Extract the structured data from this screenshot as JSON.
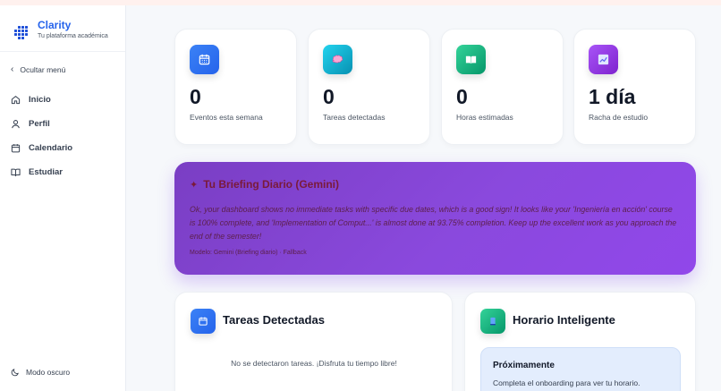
{
  "brand": {
    "name": "Clarity",
    "subtitle": "Tu plataforma académica"
  },
  "sidebar": {
    "collapse_label": "Ocultar menú",
    "items": [
      {
        "label": "Inicio",
        "icon": "home-icon"
      },
      {
        "label": "Perfil",
        "icon": "user-icon"
      },
      {
        "label": "Calendario",
        "icon": "calendar-icon"
      },
      {
        "label": "Estudiar",
        "icon": "book-icon"
      }
    ],
    "dark_mode_label": "Modo oscuro"
  },
  "stats": [
    {
      "value": "0",
      "label": "Eventos esta semana",
      "icon": "calendar-icon",
      "color": "#3b82f6"
    },
    {
      "value": "0",
      "label": "Tareas detectadas",
      "icon": "brain-icon",
      "color": "#06b6d4"
    },
    {
      "value": "0",
      "label": "Horas estimadas",
      "icon": "book-icon",
      "color": "#10b981"
    },
    {
      "value": "1 día",
      "label": "Racha de estudio",
      "icon": "chart-icon",
      "color": "#9333ea"
    }
  ],
  "briefing": {
    "title": "Tu Briefing Diario (Gemini)",
    "text": "Ok, your dashboard shows no immediate tasks with specific due dates, which is a good sign! It looks like your 'Ingeniería en acción' course is 100% complete, and 'Implementation of Comput...' is almost done at 93.75% completion. Keep up the excellent work as you approach the end of the semester!",
    "footnote": "Modelo: Gemini (Briefing diario) · Fallback"
  },
  "tasks_card": {
    "title": "Tareas Detectadas",
    "empty_text": "No se detectaron tareas. ¡Disfruta tu tiempo libre!"
  },
  "schedule_card": {
    "title": "Horario Inteligente",
    "soon_title": "Próximamente",
    "soon_text": "Completa el onboarding para ver tu horario."
  },
  "colors": {
    "brand": "#2563eb",
    "briefing": "#8b45e0",
    "tasks": "#3b82f6",
    "schedule": "#10b981"
  }
}
